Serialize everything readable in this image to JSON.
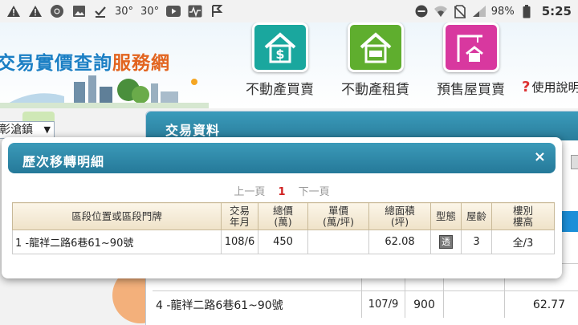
{
  "status_bar": {
    "temp1": "30°",
    "temp2": "30°",
    "battery": "98%",
    "time": "5:25"
  },
  "header": {
    "site_title_main": "交易實價查詢",
    "site_title_accent": "服務網",
    "nav": [
      {
        "label": "不動產買賣",
        "icon": "house-dollar-icon",
        "color": "#1aa79e"
      },
      {
        "label": "不動產租賃",
        "icon": "house-for-rent-icon",
        "color": "#5fae2e"
      },
      {
        "label": "預售屋買賣",
        "icon": "crane-house-icon",
        "color": "#d8389f"
      }
    ],
    "help_label": "使用說明"
  },
  "background": {
    "district_select": "彰滄鎮",
    "panel_title": "交易資料",
    "row4": {
      "location": "4  -龍祥二路6巷61~90號",
      "date": "107/9",
      "price": "900",
      "area": "62.77"
    }
  },
  "dialog": {
    "title": "歷次移轉明細",
    "close_label": "×",
    "pager": {
      "prev": "上一頁",
      "current": "1",
      "next": "下一頁"
    },
    "columns": [
      "區段位置或區段門牌",
      "交易年月",
      "總價(萬)",
      "單價(萬/坪)",
      "總面積(坪)",
      "型態",
      "屋齡",
      "樓別樓高"
    ],
    "column_lines": [
      [
        "區段位置或區段門牌"
      ],
      [
        "交易",
        "年月"
      ],
      [
        "總價",
        "(萬)"
      ],
      [
        "單價",
        "(萬/坪)"
      ],
      [
        "總面積",
        "(坪)"
      ],
      [
        "型態"
      ],
      [
        "屋齡"
      ],
      [
        "樓別",
        "樓高"
      ]
    ],
    "rows": [
      {
        "location": "1  -龍祥二路6巷61~90號",
        "date": "108/6",
        "total_price": "450",
        "unit_price": "",
        "area": "62.08",
        "type": "透",
        "age": "3",
        "floor": "全/3"
      }
    ]
  }
}
